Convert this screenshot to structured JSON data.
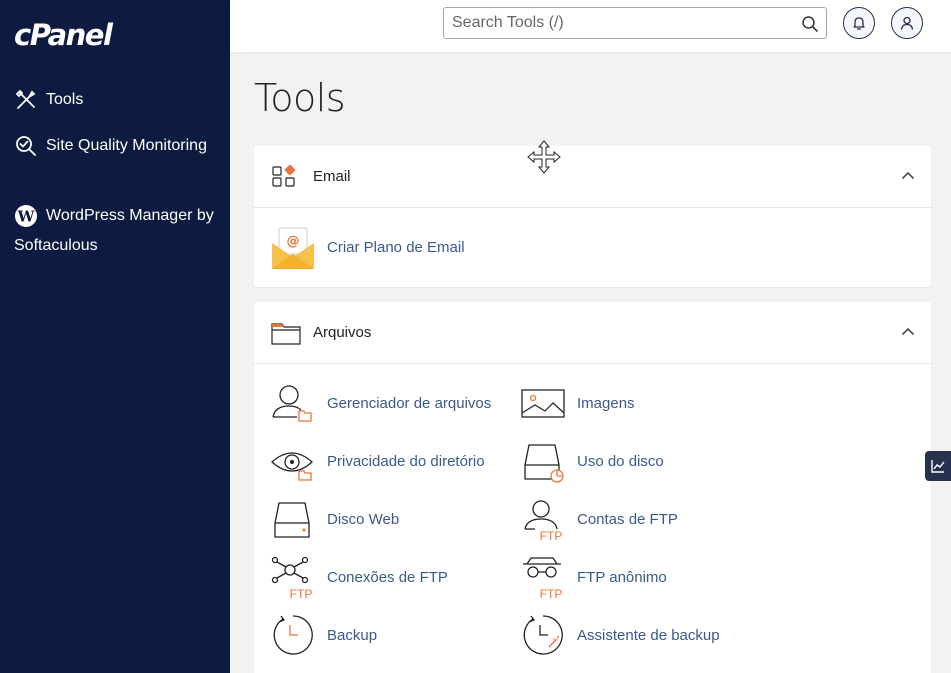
{
  "sidebar": {
    "logo": "cPanel",
    "items": [
      {
        "label": "Tools",
        "icon": "tools-icon"
      },
      {
        "label": "Site Quality Monitoring",
        "icon": "magnifier-check-icon"
      },
      {
        "label": "WordPress Manager by Softaculous",
        "icon": "wordpress-icon"
      }
    ]
  },
  "topbar": {
    "search_placeholder": "Search Tools (/)",
    "icons": [
      "search-icon",
      "bell-icon",
      "user-icon"
    ]
  },
  "main": {
    "title": "Tools",
    "sections": [
      {
        "title": "Email",
        "icon": "email-section-icon",
        "items": [
          {
            "label": "Criar Plano de Email",
            "icon": "email-envelope-icon"
          }
        ]
      },
      {
        "title": "Arquivos",
        "icon": "folder-icon",
        "items": [
          {
            "label": "Gerenciador de arquivos",
            "icon": "file-manager-icon"
          },
          {
            "label": "Imagens",
            "icon": "images-icon"
          },
          {
            "label": "Privacidade do diretório",
            "icon": "directory-privacy-icon"
          },
          {
            "label": "Uso do disco",
            "icon": "disk-usage-icon"
          },
          {
            "label": "Disco Web",
            "icon": "web-disk-icon"
          },
          {
            "label": "Contas de FTP",
            "icon": "ftp-accounts-icon"
          },
          {
            "label": "Conexões de FTP",
            "icon": "ftp-connections-icon"
          },
          {
            "label": "FTP anônimo",
            "icon": "anonymous-ftp-icon"
          },
          {
            "label": "Backup",
            "icon": "backup-icon"
          },
          {
            "label": "Assistente de backup",
            "icon": "backup-wizard-icon"
          }
        ]
      }
    ]
  },
  "colors": {
    "sidebar_bg": "#0c1b3f",
    "link": "#3a5a8c",
    "accent_orange": "#e8753a"
  }
}
